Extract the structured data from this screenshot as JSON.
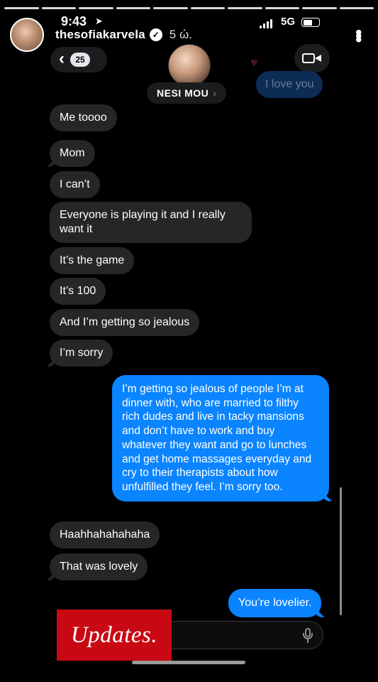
{
  "status_bar": {
    "time": "9:43",
    "network": "5G"
  },
  "story": {
    "username": "thesofiakarvela",
    "verified_mark": "✓",
    "posted_ago": "5 ώ.",
    "more_glyph": "•••",
    "segments": 10
  },
  "conversation": {
    "back_glyph": "‹",
    "unread_count": "25",
    "contact_name": "NESI MOU",
    "contact_chevron": "›",
    "faded_heart": "♥",
    "faded_message": "I love you"
  },
  "messages": [
    {
      "side": "in",
      "text": "Me toooo"
    },
    {
      "side": "in",
      "text": "Mom"
    },
    {
      "side": "in",
      "text": "I can’t"
    },
    {
      "side": "in",
      "text": "Everyone is playing it and I really want it"
    },
    {
      "side": "in",
      "text": "It’s the game"
    },
    {
      "side": "in",
      "text": "It’s 100"
    },
    {
      "side": "in",
      "text": "And I’m getting so jealous"
    },
    {
      "side": "in",
      "text": "I’m sorry"
    },
    {
      "side": "out",
      "text": "I’m getting so jealous of people I’m at dinner with, who are married to filthy rich dudes and live in tacky mansions and don’t have to work and buy whatever they want and go to lunches and get home massages everyday and cry to their therapists about how unfulfilled they feel. I’m sorry too."
    },
    {
      "side": "in",
      "text": "Haahhahahahaha"
    },
    {
      "side": "in",
      "text": "That was lovely"
    },
    {
      "side": "out",
      "text": "You’re lovelier."
    }
  ],
  "sticker": {
    "text": "Updates.",
    "color": "#c80914"
  },
  "colors": {
    "incoming_bubble": "#262628",
    "outgoing_bubble": "#0a84ff",
    "background": "#000000"
  }
}
